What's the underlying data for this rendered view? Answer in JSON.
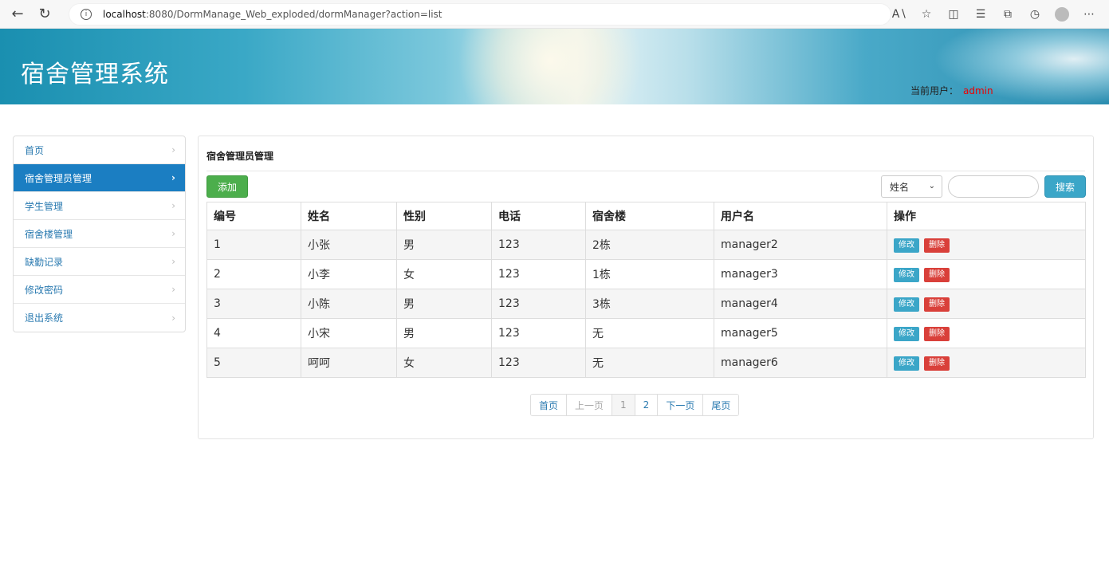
{
  "browser": {
    "url_host": "localhost",
    "url_rest": ":8080/DormManage_Web_exploded/dormManager?action=list"
  },
  "header": {
    "title": "宿舍管理系统",
    "user_label": "当前用户：",
    "user_name": "admin"
  },
  "sidebar": {
    "items": [
      {
        "label": "首页"
      },
      {
        "label": "宿舍管理员管理"
      },
      {
        "label": "学生管理"
      },
      {
        "label": "宿舍楼管理"
      },
      {
        "label": "缺勤记录"
      },
      {
        "label": "修改密码"
      },
      {
        "label": "退出系统"
      }
    ],
    "active_index": 1
  },
  "main": {
    "title": "宿舍管理员管理",
    "add_label": "添加",
    "search_field_selected": "姓名",
    "search_label": "搜索",
    "table": {
      "headers": [
        "编号",
        "姓名",
        "性别",
        "电话",
        "宿舍楼",
        "用户名",
        "操作"
      ],
      "rows": [
        {
          "id": "1",
          "name": "小张",
          "gender": "男",
          "phone": "123",
          "building": "2栋",
          "username": "manager2"
        },
        {
          "id": "2",
          "name": "小李",
          "gender": "女",
          "phone": "123",
          "building": "1栋",
          "username": "manager3"
        },
        {
          "id": "3",
          "name": "小陈",
          "gender": "男",
          "phone": "123",
          "building": "3栋",
          "username": "manager4"
        },
        {
          "id": "4",
          "name": "小宋",
          "gender": "男",
          "phone": "123",
          "building": "无",
          "username": "manager5"
        },
        {
          "id": "5",
          "name": "呵呵",
          "gender": "女",
          "phone": "123",
          "building": "无",
          "username": "manager6"
        }
      ],
      "edit_label": "修改",
      "delete_label": "删除"
    },
    "pagination": {
      "first": "首页",
      "prev": "上一页",
      "pages": [
        "1",
        "2"
      ],
      "next": "下一页",
      "last": "尾页"
    }
  },
  "colors": {
    "primary": "#1b7ec2",
    "add_button": "#4cae4c",
    "info_button": "#3ba6c8",
    "danger_button": "#d9403a",
    "user_name": "#ee0000"
  }
}
